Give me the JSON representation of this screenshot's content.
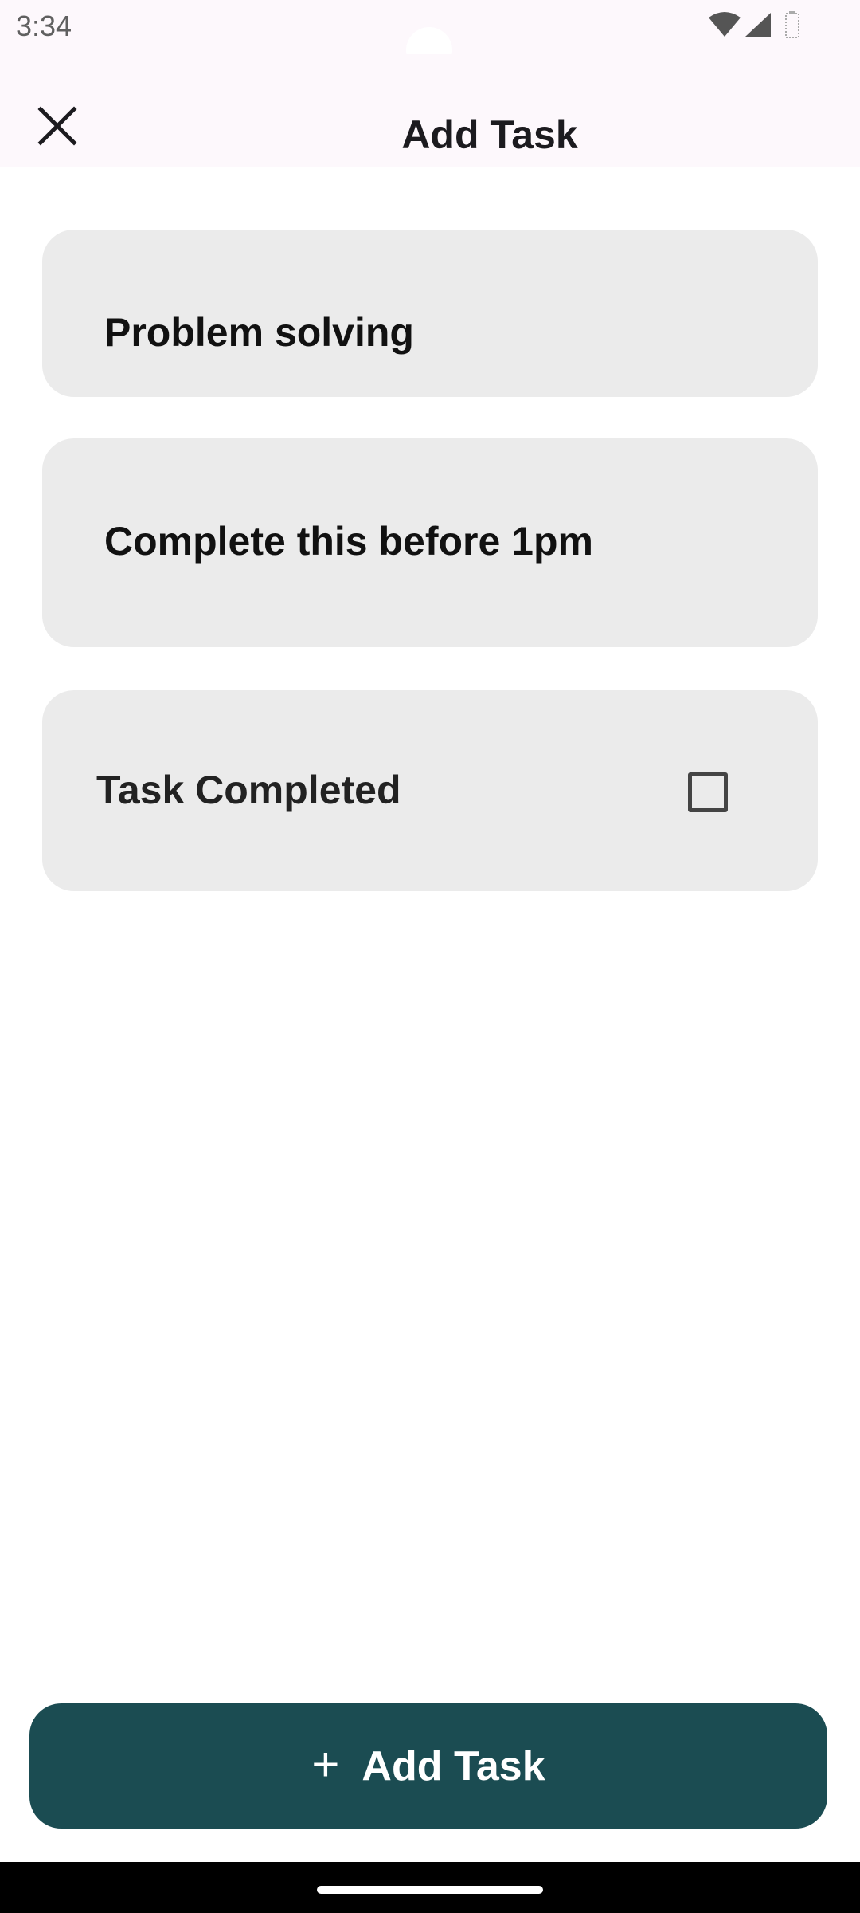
{
  "status_bar": {
    "time": "3:34",
    "icons": [
      "wifi-icon",
      "signal-icon",
      "battery-icon"
    ]
  },
  "top_bar": {
    "title": "Add Task",
    "close_icon": "close-icon"
  },
  "form": {
    "title_value": "Problem solving",
    "description_value": "Complete this before 1pm",
    "completed_label": "Task Completed",
    "completed_checked": false
  },
  "actions": {
    "add_task_label": "Add Task",
    "add_task_icon": "+"
  },
  "colors": {
    "accent": "#1b4c52",
    "card_background": "#ebebeb",
    "bar_background": "#fdf8fc"
  }
}
